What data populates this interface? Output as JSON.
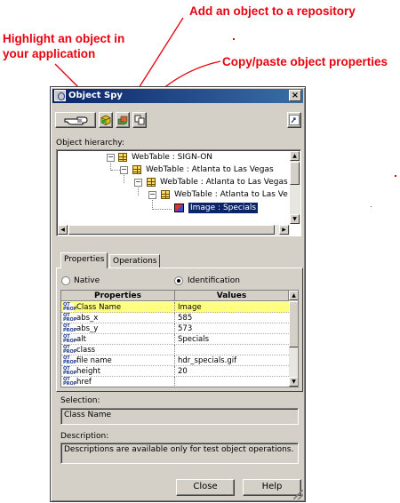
{
  "annotations": {
    "highlight_line1": "Highlight an object in",
    "highlight_line2": "your application",
    "add": "Add an object to a repository",
    "copy": "Copy/paste object properties"
  },
  "colors": {
    "annotation": "#e8000e",
    "dialog_face": "#d4d0c8",
    "title_start": "#0a246a",
    "title_end": "#3a6ea5",
    "selected_row": "#ffff80",
    "tree_selection": "#0a246a"
  },
  "window": {
    "title": "Object Spy",
    "close_glyph": "×"
  },
  "toolbar": {
    "icons": [
      "pointing-hand-icon",
      "highlight-cube-icon",
      "add-to-repository-icon",
      "copy-paste-icon",
      "help-icon"
    ]
  },
  "hierarchy": {
    "label": "Object hierarchy:",
    "nodes": [
      {
        "label": "WebTable : SIGN-ON"
      },
      {
        "label": "WebTable : Atlanta to Las Vegas"
      },
      {
        "label": "WebTable : Atlanta to Las Vegas"
      },
      {
        "label": "WebTable : Atlanta to Las Ve"
      },
      {
        "label": "Image : Specials",
        "selected": true
      }
    ]
  },
  "tabs": [
    {
      "label": "Properties",
      "active": true
    },
    {
      "label": "Operations",
      "active": false
    }
  ],
  "mode": {
    "native_label": "Native",
    "identification_label": "Identification",
    "selected": "Identification"
  },
  "grid": {
    "headers": [
      "Properties",
      "Values"
    ],
    "rows": [
      {
        "property": "Class Name",
        "value": "Image",
        "selected": true
      },
      {
        "property": "abs_x",
        "value": "585"
      },
      {
        "property": "abs_y",
        "value": "573"
      },
      {
        "property": "alt",
        "value": "Specials"
      },
      {
        "property": "class",
        "value": ""
      },
      {
        "property": "file name",
        "value": "hdr_specials.gif"
      },
      {
        "property": "height",
        "value": "20"
      },
      {
        "property": "href",
        "value": ""
      }
    ]
  },
  "selection": {
    "label": "Selection:",
    "value": "Class Name"
  },
  "description": {
    "label": "Description:",
    "value": "Descriptions are available only for test object operations."
  },
  "buttons": {
    "close": "Close",
    "help": "Help"
  }
}
